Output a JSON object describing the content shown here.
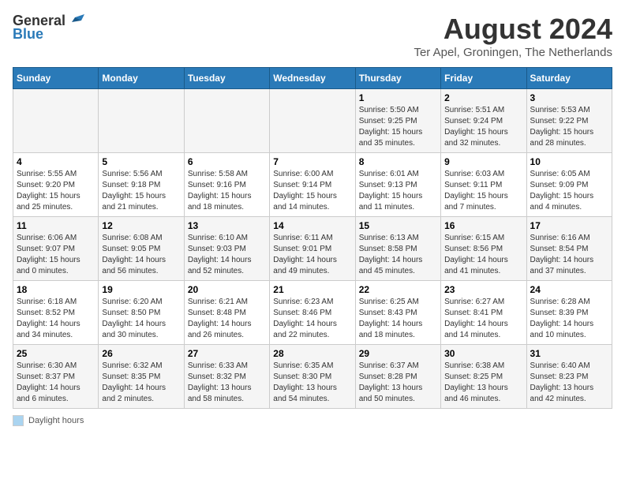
{
  "header": {
    "logo_general": "General",
    "logo_blue": "Blue",
    "title": "August 2024",
    "subtitle": "Ter Apel, Groningen, The Netherlands"
  },
  "weekdays": [
    "Sunday",
    "Monday",
    "Tuesday",
    "Wednesday",
    "Thursday",
    "Friday",
    "Saturday"
  ],
  "footer": {
    "label": "Daylight hours"
  },
  "weeks": [
    [
      {
        "day": "",
        "info": ""
      },
      {
        "day": "",
        "info": ""
      },
      {
        "day": "",
        "info": ""
      },
      {
        "day": "",
        "info": ""
      },
      {
        "day": "1",
        "info": "Sunrise: 5:50 AM\nSunset: 9:25 PM\nDaylight: 15 hours and 35 minutes."
      },
      {
        "day": "2",
        "info": "Sunrise: 5:51 AM\nSunset: 9:24 PM\nDaylight: 15 hours and 32 minutes."
      },
      {
        "day": "3",
        "info": "Sunrise: 5:53 AM\nSunset: 9:22 PM\nDaylight: 15 hours and 28 minutes."
      }
    ],
    [
      {
        "day": "4",
        "info": "Sunrise: 5:55 AM\nSunset: 9:20 PM\nDaylight: 15 hours and 25 minutes."
      },
      {
        "day": "5",
        "info": "Sunrise: 5:56 AM\nSunset: 9:18 PM\nDaylight: 15 hours and 21 minutes."
      },
      {
        "day": "6",
        "info": "Sunrise: 5:58 AM\nSunset: 9:16 PM\nDaylight: 15 hours and 18 minutes."
      },
      {
        "day": "7",
        "info": "Sunrise: 6:00 AM\nSunset: 9:14 PM\nDaylight: 15 hours and 14 minutes."
      },
      {
        "day": "8",
        "info": "Sunrise: 6:01 AM\nSunset: 9:13 PM\nDaylight: 15 hours and 11 minutes."
      },
      {
        "day": "9",
        "info": "Sunrise: 6:03 AM\nSunset: 9:11 PM\nDaylight: 15 hours and 7 minutes."
      },
      {
        "day": "10",
        "info": "Sunrise: 6:05 AM\nSunset: 9:09 PM\nDaylight: 15 hours and 4 minutes."
      }
    ],
    [
      {
        "day": "11",
        "info": "Sunrise: 6:06 AM\nSunset: 9:07 PM\nDaylight: 15 hours and 0 minutes."
      },
      {
        "day": "12",
        "info": "Sunrise: 6:08 AM\nSunset: 9:05 PM\nDaylight: 14 hours and 56 minutes."
      },
      {
        "day": "13",
        "info": "Sunrise: 6:10 AM\nSunset: 9:03 PM\nDaylight: 14 hours and 52 minutes."
      },
      {
        "day": "14",
        "info": "Sunrise: 6:11 AM\nSunset: 9:01 PM\nDaylight: 14 hours and 49 minutes."
      },
      {
        "day": "15",
        "info": "Sunrise: 6:13 AM\nSunset: 8:58 PM\nDaylight: 14 hours and 45 minutes."
      },
      {
        "day": "16",
        "info": "Sunrise: 6:15 AM\nSunset: 8:56 PM\nDaylight: 14 hours and 41 minutes."
      },
      {
        "day": "17",
        "info": "Sunrise: 6:16 AM\nSunset: 8:54 PM\nDaylight: 14 hours and 37 minutes."
      }
    ],
    [
      {
        "day": "18",
        "info": "Sunrise: 6:18 AM\nSunset: 8:52 PM\nDaylight: 14 hours and 34 minutes."
      },
      {
        "day": "19",
        "info": "Sunrise: 6:20 AM\nSunset: 8:50 PM\nDaylight: 14 hours and 30 minutes."
      },
      {
        "day": "20",
        "info": "Sunrise: 6:21 AM\nSunset: 8:48 PM\nDaylight: 14 hours and 26 minutes."
      },
      {
        "day": "21",
        "info": "Sunrise: 6:23 AM\nSunset: 8:46 PM\nDaylight: 14 hours and 22 minutes."
      },
      {
        "day": "22",
        "info": "Sunrise: 6:25 AM\nSunset: 8:43 PM\nDaylight: 14 hours and 18 minutes."
      },
      {
        "day": "23",
        "info": "Sunrise: 6:27 AM\nSunset: 8:41 PM\nDaylight: 14 hours and 14 minutes."
      },
      {
        "day": "24",
        "info": "Sunrise: 6:28 AM\nSunset: 8:39 PM\nDaylight: 14 hours and 10 minutes."
      }
    ],
    [
      {
        "day": "25",
        "info": "Sunrise: 6:30 AM\nSunset: 8:37 PM\nDaylight: 14 hours and 6 minutes."
      },
      {
        "day": "26",
        "info": "Sunrise: 6:32 AM\nSunset: 8:35 PM\nDaylight: 14 hours and 2 minutes."
      },
      {
        "day": "27",
        "info": "Sunrise: 6:33 AM\nSunset: 8:32 PM\nDaylight: 13 hours and 58 minutes."
      },
      {
        "day": "28",
        "info": "Sunrise: 6:35 AM\nSunset: 8:30 PM\nDaylight: 13 hours and 54 minutes."
      },
      {
        "day": "29",
        "info": "Sunrise: 6:37 AM\nSunset: 8:28 PM\nDaylight: 13 hours and 50 minutes."
      },
      {
        "day": "30",
        "info": "Sunrise: 6:38 AM\nSunset: 8:25 PM\nDaylight: 13 hours and 46 minutes."
      },
      {
        "day": "31",
        "info": "Sunrise: 6:40 AM\nSunset: 8:23 PM\nDaylight: 13 hours and 42 minutes."
      }
    ]
  ]
}
